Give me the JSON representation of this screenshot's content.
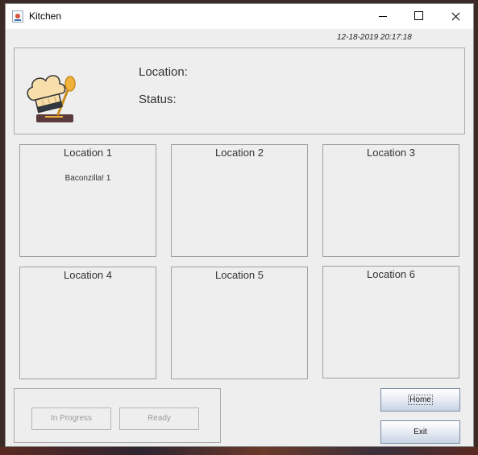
{
  "window": {
    "title": "Kitchen"
  },
  "header": {
    "datetime": "12-18-2019 20:17:18",
    "location_label": "Location:",
    "status_label": "Status:"
  },
  "locations": [
    {
      "title": "Location 1",
      "items": [
        "Baconzilla!  1"
      ]
    },
    {
      "title": "Location 2",
      "items": []
    },
    {
      "title": "Location 3",
      "items": []
    },
    {
      "title": "Location 4",
      "items": []
    },
    {
      "title": "Location 5",
      "items": []
    },
    {
      "title": "Location 6",
      "items": []
    }
  ],
  "actions": {
    "in_progress_label": "In Progress",
    "ready_label": "Ready"
  },
  "nav": {
    "home_label": "Home",
    "exit_label": "Exit"
  }
}
